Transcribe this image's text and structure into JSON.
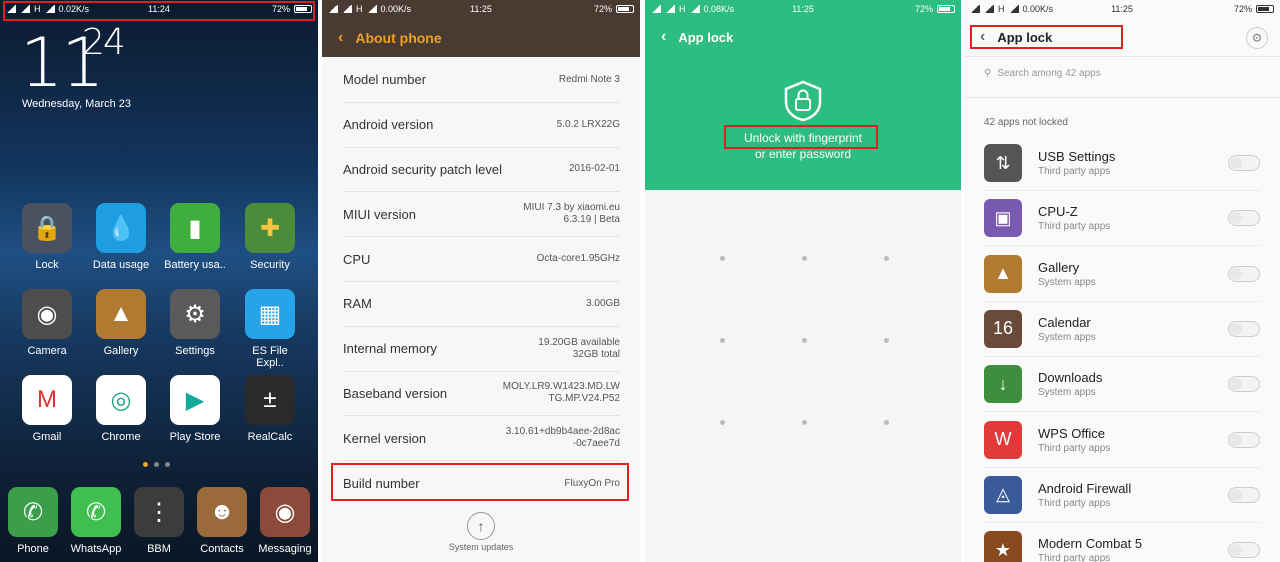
{
  "panel1": {
    "status": {
      "speed": "0.02K/s",
      "net": "H",
      "time": "11:24",
      "battery": "72%"
    },
    "clock": {
      "hour": "11",
      "min": "24"
    },
    "date": "Wednesday, March 23",
    "apps": [
      {
        "label": "Lock",
        "icon": "lock-icon",
        "color": "#4a5260"
      },
      {
        "label": "Data usage",
        "icon": "water-drop-icon",
        "color": "#1e9ee0"
      },
      {
        "label": "Battery usa..",
        "icon": "battery-icon",
        "color": "#3fae3f"
      },
      {
        "label": "Security",
        "icon": "shield-plus-icon",
        "color": "#4a8c3a"
      },
      {
        "label": "Camera",
        "icon": "camera-icon",
        "color": "#4d4d4d"
      },
      {
        "label": "Gallery",
        "icon": "gallery-icon",
        "color": "#b07a30"
      },
      {
        "label": "Settings",
        "icon": "gear-icon",
        "color": "#5a5a5a"
      },
      {
        "label": "ES File Expl..",
        "icon": "folder-icon",
        "color": "#25a4e8"
      },
      {
        "label": "Gmail",
        "icon": "gmail-icon",
        "color": "#ffffff"
      },
      {
        "label": "Chrome",
        "icon": "chrome-icon",
        "color": "#ffffff"
      },
      {
        "label": "Play Store",
        "icon": "play-store-icon",
        "color": "#ffffff"
      },
      {
        "label": "RealCalc",
        "icon": "calculator-icon",
        "color": "#2a2a2a"
      }
    ],
    "dock": [
      {
        "label": "Phone",
        "icon": "phone-icon",
        "color": "#3a9e4a"
      },
      {
        "label": "WhatsApp",
        "icon": "whatsapp-icon",
        "color": "#3fbf4f"
      },
      {
        "label": "BBM",
        "icon": "bbm-icon",
        "color": "#3c3c3c"
      },
      {
        "label": "Contacts",
        "icon": "contacts-icon",
        "color": "#9a6a3a"
      },
      {
        "label": "Messaging",
        "icon": "messaging-icon",
        "color": "#8b4a3a"
      }
    ]
  },
  "panel2": {
    "status": {
      "speed": "0.00K/s",
      "net": "H",
      "time": "11:25",
      "battery": "72%"
    },
    "title": "About phone",
    "rows": [
      {
        "k": "Model number",
        "v1": "Redmi Note 3",
        "v2": ""
      },
      {
        "k": "Android version",
        "v1": "5.0.2 LRX22G",
        "v2": ""
      },
      {
        "k": "Android security patch level",
        "v1": "2016-02-01",
        "v2": ""
      },
      {
        "k": "MIUI version",
        "v1": "MIUI 7.3 by xiaomi.eu",
        "v2": "6.3.19 | Beta"
      },
      {
        "k": "CPU",
        "v1": "Octa-core1.95GHz",
        "v2": ""
      },
      {
        "k": "RAM",
        "v1": "3.00GB",
        "v2": ""
      },
      {
        "k": "Internal memory",
        "v1": "19.20GB available",
        "v2": "32GB total"
      },
      {
        "k": "Baseband version",
        "v1": "MOLY.LR9.W1423.MD.LW",
        "v2": "TG.MP.V24.P52"
      },
      {
        "k": "Kernel version",
        "v1": "3.10.61+db9b4aee-2d8ac",
        "v2": "-0c7aee7d"
      },
      {
        "k": "Build number",
        "v1": "FluxyOn Pro",
        "v2": ""
      }
    ],
    "updates": "System updates"
  },
  "panel3": {
    "status": {
      "speed": "0.08K/s",
      "net": "H",
      "time": "11:25",
      "battery": "72%"
    },
    "title": "App lock",
    "line1": "Unlock with fingerprint",
    "line2": "or enter password"
  },
  "panel4": {
    "status": {
      "speed": "0.00K/s",
      "net": "H",
      "time": "11:25",
      "battery": "72%"
    },
    "title": "App lock",
    "search_placeholder": "Search among 42 apps",
    "section": "42 apps not locked",
    "apps": [
      {
        "name": "USB Settings",
        "sub": "Third party apps",
        "icon": "usb-icon",
        "color": "#555555"
      },
      {
        "name": "CPU-Z",
        "sub": "Third party apps",
        "icon": "cpu-icon",
        "color": "#7a5ab0"
      },
      {
        "name": "Gallery",
        "sub": "System apps",
        "icon": "gallery-icon",
        "color": "#b07a30"
      },
      {
        "name": "Calendar",
        "sub": "System apps",
        "icon": "calendar-icon",
        "color": "#6a4a3a"
      },
      {
        "name": "Downloads",
        "sub": "System apps",
        "icon": "download-icon",
        "color": "#3e8e3e"
      },
      {
        "name": "WPS Office",
        "sub": "Third party apps",
        "icon": "wps-icon",
        "color": "#e03a3a"
      },
      {
        "name": "Android Firewall",
        "sub": "Third party apps",
        "icon": "firewall-icon",
        "color": "#3a5a9a"
      },
      {
        "name": "Modern Combat 5",
        "sub": "Third party apps",
        "icon": "game-icon",
        "color": "#8a4a20"
      }
    ]
  }
}
